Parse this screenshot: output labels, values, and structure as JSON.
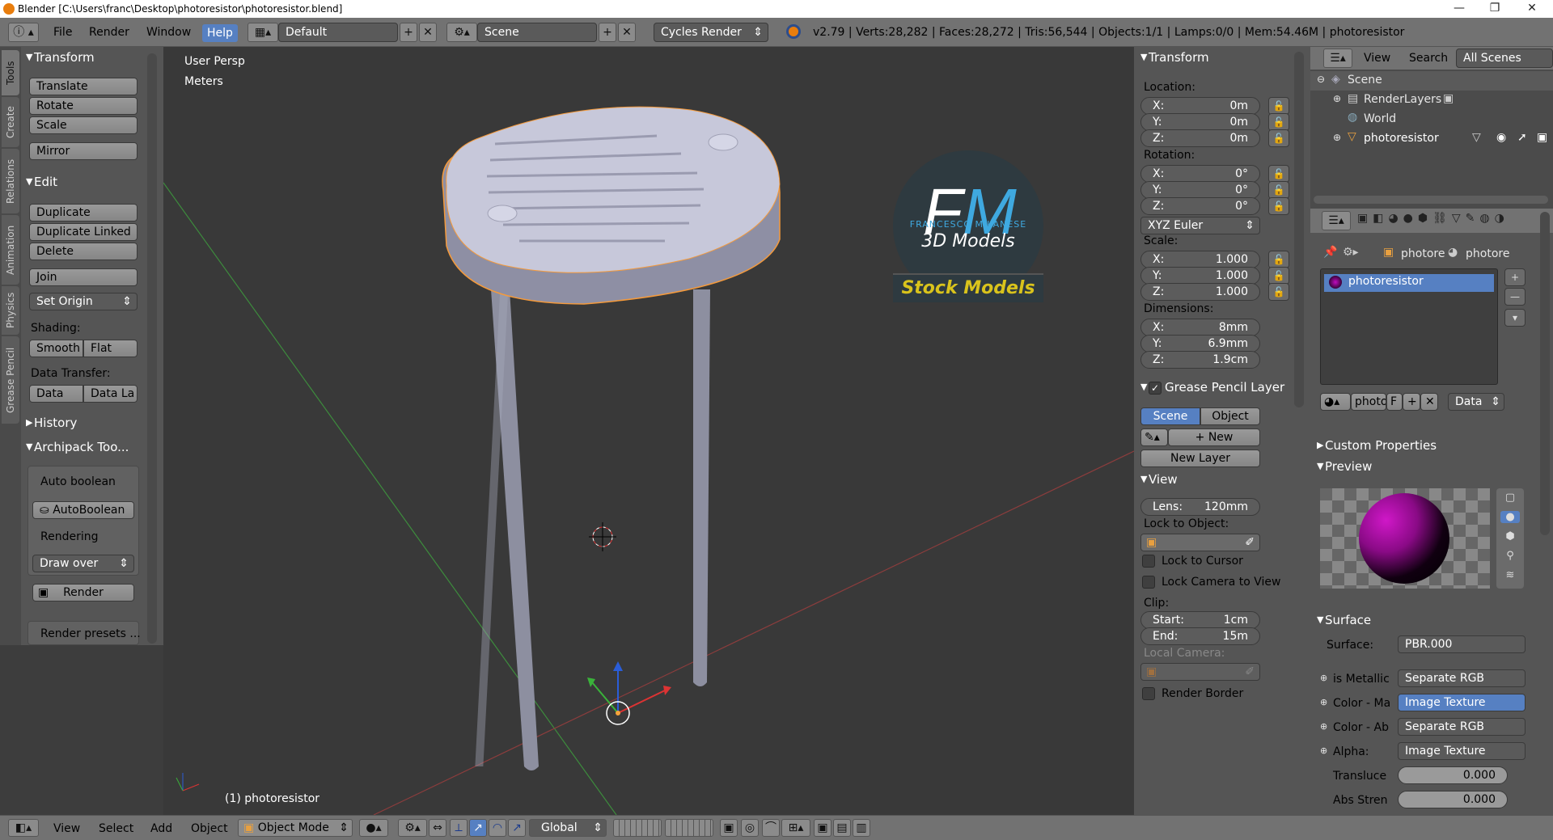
{
  "window": {
    "title": "Blender [C:\\Users\\franc\\Desktop\\photoresistor\\photoresistor.blend]",
    "minimize": "—",
    "maximize": "❐",
    "close": "✕"
  },
  "top": {
    "menus": [
      "File",
      "Render",
      "Window",
      "Help"
    ],
    "screen_layout": "Default",
    "scene": "Scene",
    "engine": "Cycles Render",
    "stats": "v2.79 | Verts:28,282 | Faces:28,272 | Tris:56,544 | Objects:1/1 | Lamps:0/0 | Mem:54.46M | photoresistor"
  },
  "tabs": [
    "Tools",
    "Create",
    "Relations",
    "Animation",
    "Physics",
    "Grease Pencil"
  ],
  "toolshelf": {
    "transform": {
      "title": "Transform",
      "buttons": [
        "Translate",
        "Rotate",
        "Scale",
        "Mirror"
      ]
    },
    "edit": {
      "title": "Edit",
      "buttons": [
        "Duplicate",
        "Duplicate Linked",
        "Delete",
        "Join"
      ],
      "set_origin": "Set Origin",
      "shading_label": "Shading:",
      "smooth": "Smooth",
      "flat": "Flat",
      "data_transfer_label": "Data Transfer:",
      "data": "Data",
      "data_la": "Data La"
    },
    "history": "History",
    "archipack": {
      "title": "Archipack Too...",
      "auto_boolean_label": "Auto boolean",
      "auto_boolean_btn": "AutoBoolean",
      "rendering_label": "Rendering",
      "draw_over": "Draw over",
      "render": "Render",
      "render_presets": "Render presets ..."
    }
  },
  "viewport": {
    "view_name": "User Persp",
    "units": "Meters",
    "object_label": "(1) photoresistor"
  },
  "logo": {
    "letters": "FM",
    "name": "FRANCESCO MILANESE",
    "tagline": "3D Models",
    "banner": "Stock Models"
  },
  "npanel": {
    "transform_title": "Transform",
    "location_label": "Location:",
    "location": [
      {
        "k": "X:",
        "v": "0m"
      },
      {
        "k": "Y:",
        "v": "0m"
      },
      {
        "k": "Z:",
        "v": "0m"
      }
    ],
    "rotation_label": "Rotation:",
    "rotation": [
      {
        "k": "X:",
        "v": "0°"
      },
      {
        "k": "Y:",
        "v": "0°"
      },
      {
        "k": "Z:",
        "v": "0°"
      }
    ],
    "rotation_mode": "XYZ Euler",
    "scale_label": "Scale:",
    "scale": [
      {
        "k": "X:",
        "v": "1.000"
      },
      {
        "k": "Y:",
        "v": "1.000"
      },
      {
        "k": "Z:",
        "v": "1.000"
      }
    ],
    "dimensions_label": "Dimensions:",
    "dimensions": [
      {
        "k": "X:",
        "v": "8mm"
      },
      {
        "k": "Y:",
        "v": "6.9mm"
      },
      {
        "k": "Z:",
        "v": "1.9cm"
      }
    ],
    "gp_title": "Grease Pencil Layer",
    "gp_scene": "Scene",
    "gp_object": "Object",
    "gp_new": "New",
    "gp_new_layer": "New Layer",
    "view_title": "View",
    "lens": {
      "k": "Lens:",
      "v": "120mm"
    },
    "lock_to_object": "Lock to Object:",
    "lock_to_cursor": "Lock to Cursor",
    "lock_camera": "Lock Camera to View",
    "clip_label": "Clip:",
    "clip_start": {
      "k": "Start:",
      "v": "1cm"
    },
    "clip_end": {
      "k": "End:",
      "v": "15m"
    },
    "local_camera": "Local Camera:",
    "render_border": "Render Border"
  },
  "outliner": {
    "view": "View",
    "search": "Search",
    "filter": "All Scenes",
    "items": [
      "Scene",
      "RenderLayers",
      "World",
      "photoresistor"
    ]
  },
  "props": {
    "breadcrumb1": "photore",
    "breadcrumb2": "photore",
    "material": "photoresistor",
    "mat_field": "photo",
    "mat_f": "F",
    "link": "Data",
    "custom_properties": "Custom Properties",
    "preview": "Preview",
    "surface_title": "Surface",
    "surface_label": "Surface:",
    "surface_value": "PBR.000",
    "rows": [
      {
        "k": "is Metallic",
        "v": "Separate RGB"
      },
      {
        "k": "Color - Ma",
        "v": "Image Texture"
      },
      {
        "k": "Color - Ab",
        "v": "Separate RGB"
      },
      {
        "k": "Alpha:",
        "v": "Image Texture"
      }
    ],
    "translucent": {
      "k": "Transluce",
      "v": "0.000"
    },
    "abs": {
      "k": "Abs Stren",
      "v": "0.000"
    }
  },
  "bottom": {
    "menus": [
      "View",
      "Select",
      "Add",
      "Object"
    ],
    "mode": "Object Mode",
    "orientation": "Global"
  },
  "colors": {
    "accent": "#5680c2",
    "header": "#727272",
    "panel": "#555555",
    "viewport": "#393939",
    "logo_blue": "#3fa9e0",
    "logo_yellow": "#d9c31c",
    "selection": "#f59a3b"
  }
}
